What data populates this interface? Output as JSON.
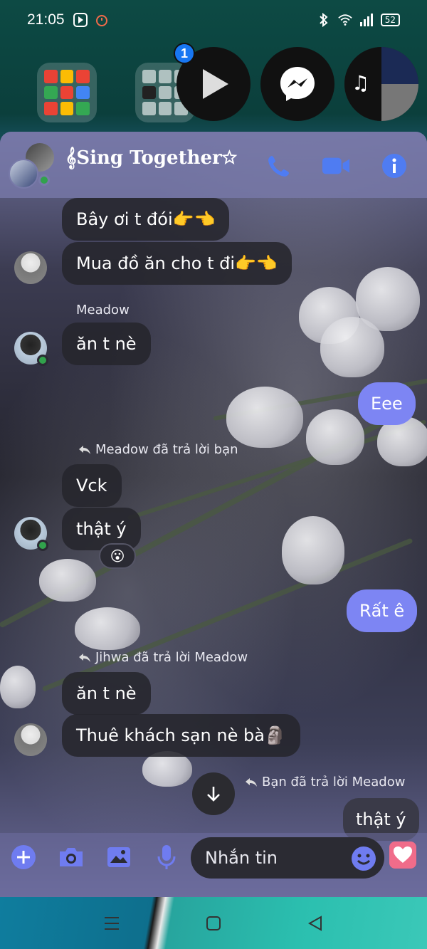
{
  "status_bar": {
    "time": "21:05",
    "battery": "52"
  },
  "floating_bubble": {
    "badge_count": "1"
  },
  "chat": {
    "title": "𝄞Sing Together☆",
    "messages": [
      {
        "sender": "",
        "text": "Bây ơi t đói👉👈",
        "direction": "in"
      },
      {
        "sender": "",
        "text": "Mua đồ ăn cho t đi👉👈",
        "direction": "in"
      },
      {
        "sender": "Meadow",
        "text": "ăn t nè",
        "direction": "in"
      },
      {
        "sender": "me",
        "text": "Eee",
        "direction": "out"
      },
      {
        "reply_note": "Meadow đã trả lời bạn"
      },
      {
        "sender": "",
        "text": "Vck",
        "direction": "in"
      },
      {
        "sender": "",
        "text": "thật ý",
        "direction": "in",
        "reaction": "😮"
      },
      {
        "sender": "me",
        "text": "Rất ê",
        "direction": "out"
      },
      {
        "reply_note": "Jihwa đã trả lời Meadow"
      },
      {
        "sender": "",
        "text": "ăn t nè",
        "direction": "in"
      },
      {
        "sender": "",
        "text": "Thuê khách sạn nè bà🗿",
        "direction": "in"
      },
      {
        "reply_note": "Bạn đã trả lời Meadow"
      },
      {
        "sender": "me",
        "text": "thật ý",
        "direction": "out"
      }
    ]
  },
  "composer": {
    "placeholder": "Nhắn tin"
  },
  "colors": {
    "accent": "#7d85f3",
    "header_icon": "#4f7cf2",
    "heart": "#f06c8a"
  }
}
